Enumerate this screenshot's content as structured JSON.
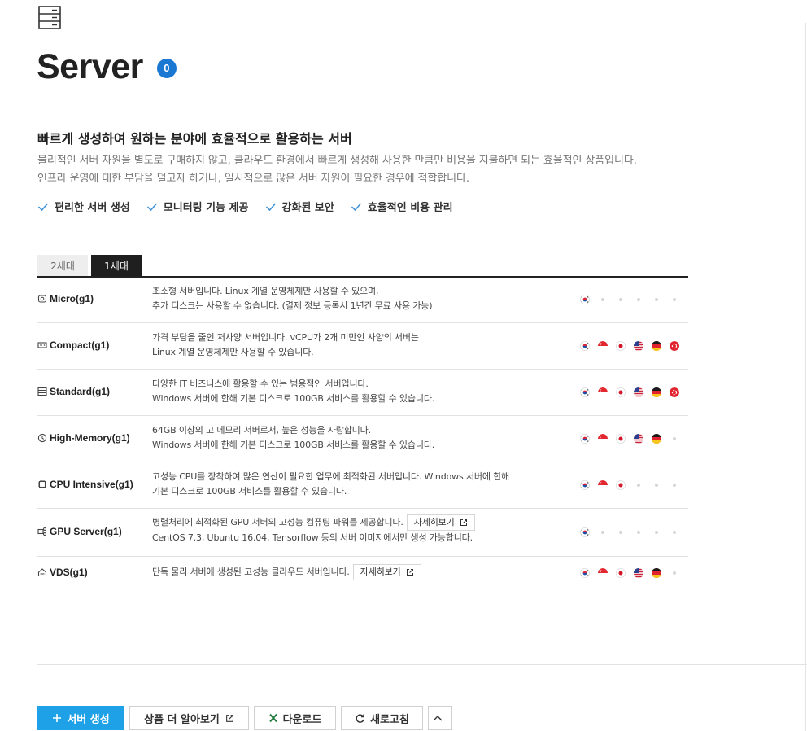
{
  "page": {
    "title": "Server",
    "count": "0",
    "headline": "빠르게 생성하여 원하는 분야에 효율적으로 활용하는 서버",
    "description_line1": "물리적인 서버 자원을 별도로 구매하지 않고, 클라우드 환경에서 빠르게 생성해 사용한 만큼만 비용을 지불하면 되는 효율적인 상품입니다.",
    "description_line2": "인프라 운영에 대한 부담을 덜고자 하거나, 일시적으로 많은 서버 자원이 필요한 경우에 적합합니다.",
    "features": [
      "편리한 서버 생성",
      "모니터링 기능 제공",
      "강화된 보안",
      "효율적인 비용 관리"
    ]
  },
  "tabs": [
    {
      "label": "2세대",
      "active": false
    },
    {
      "label": "1세대",
      "active": true
    }
  ],
  "products": [
    {
      "name": "Micro(g1)",
      "icon": "micro-server-icon",
      "lines": [
        "초소형 서버입니다. Linux 계열 운영체제만 사용할 수 있으며,",
        "추가 디스크는 사용할 수 없습니다. (결제 정보 등록시 1년간 무료 사용 가능)"
      ],
      "regions": [
        "kr",
        "none",
        "none",
        "none",
        "none",
        "none"
      ]
    },
    {
      "name": "Compact(g1)",
      "icon": "compact-server-icon",
      "lines": [
        "가격 부담을 줄인 저사양 서버입니다. vCPU가 2개 미만인 사양의 서버는",
        "Linux 계열 운영체제만 사용할 수 있습니다."
      ],
      "regions": [
        "kr",
        "sg",
        "jp",
        "us",
        "de",
        "hk"
      ]
    },
    {
      "name": "Standard(g1)",
      "icon": "standard-server-icon",
      "lines": [
        "다양한 IT 비즈니스에 활용할 수 있는 범용적인 서버입니다.",
        "Windows 서버에 한해 기본 디스크로 100GB 서비스를 활용할 수 있습니다."
      ],
      "regions": [
        "kr",
        "sg",
        "jp",
        "us",
        "de",
        "hk"
      ]
    },
    {
      "name": "High-Memory(g1)",
      "icon": "high-memory-server-icon",
      "lines": [
        "64GB 이상의 고 메모리 서버로서, 높은 성능을 자랑합니다.",
        "Windows 서버에 한해 기본 디스크로 100GB 서비스를 활용할 수 있습니다."
      ],
      "regions": [
        "kr",
        "sg",
        "jp",
        "us",
        "de",
        "none"
      ]
    },
    {
      "name": "CPU Intensive(g1)",
      "icon": "cpu-intensive-server-icon",
      "lines": [
        "고성능 CPU를 장착하여 많은 연산이 필요한 업무에 최적화된 서버입니다. Windows 서버에 한해",
        "기본 디스크로 100GB 서비스를 활용할 수 있습니다."
      ],
      "regions": [
        "kr",
        "sg",
        "jp",
        "none",
        "none",
        "none"
      ]
    },
    {
      "name": "GPU Server(g1)",
      "icon": "gpu-server-icon",
      "lines": [
        "병렬처리에 최적화된 GPU 서버의 고성능 컴퓨팅 파워를 제공합니다.",
        "CentOS 7.3, Ubuntu 16.04, Tensorflow 등의 서버 이미지에서만 생성 가능합니다."
      ],
      "detail_label": "자세히보기",
      "regions": [
        "kr",
        "none",
        "none",
        "none",
        "none",
        "none"
      ]
    },
    {
      "name": "VDS(g1)",
      "icon": "vds-server-icon",
      "lines": [
        "단독 물리 서버에 생성된 고성능 클라우드 서버입니다."
      ],
      "detail_label": "자세히보기",
      "regions": [
        "kr",
        "sg",
        "jp",
        "us",
        "de",
        "none"
      ]
    }
  ],
  "actions": {
    "create": "서버 생성",
    "learn_more": "상품 더 알아보기",
    "download": "다운로드",
    "refresh": "새로고침"
  },
  "colors": {
    "accent": "#1a78d3",
    "primary_button": "#1ea1e6",
    "active_tab": "#1f1f1f",
    "check": "#3a8fd6"
  }
}
